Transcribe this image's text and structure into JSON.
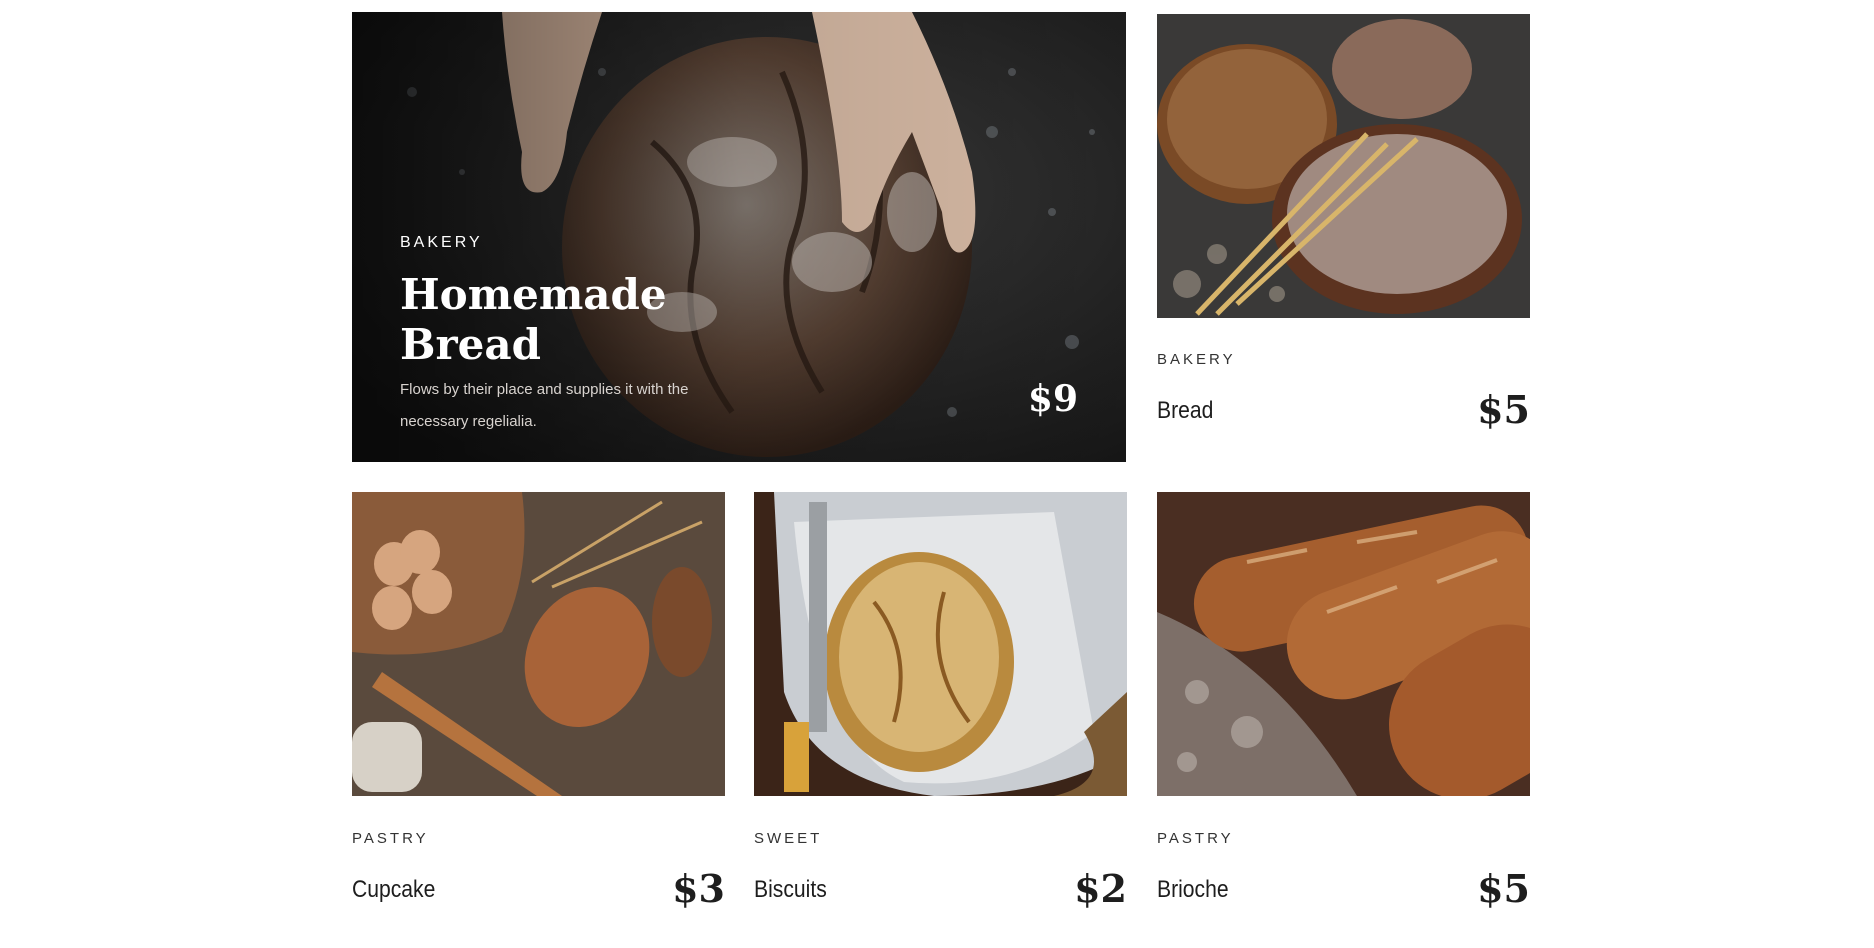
{
  "featured": {
    "category": "BAKERY",
    "title": "Homemade Bread",
    "description": "Flows by their place and supplies it with the necessary regelialia.",
    "price": "$9",
    "image_icon": "bread-loaf-in-hands-photo"
  },
  "cards": [
    {
      "category": "BAKERY",
      "name": "Bread",
      "price": "$5",
      "image_icon": "bread-loaves-with-wheat-photo"
    },
    {
      "category": "PASTRY",
      "name": "Cupcake",
      "price": "$3",
      "image_icon": "bread-with-eggs-and-rolling-pin-photo"
    },
    {
      "category": "SWEET",
      "name": "Biscuits",
      "price": "$2",
      "image_icon": "bread-in-basket-photo"
    },
    {
      "category": "PASTRY",
      "name": "Brioche",
      "price": "$5",
      "image_icon": "baguettes-photo"
    }
  ],
  "colors": {
    "text": "#1e1e1e",
    "muted": "#333333",
    "featured_text": "#ffffff"
  }
}
